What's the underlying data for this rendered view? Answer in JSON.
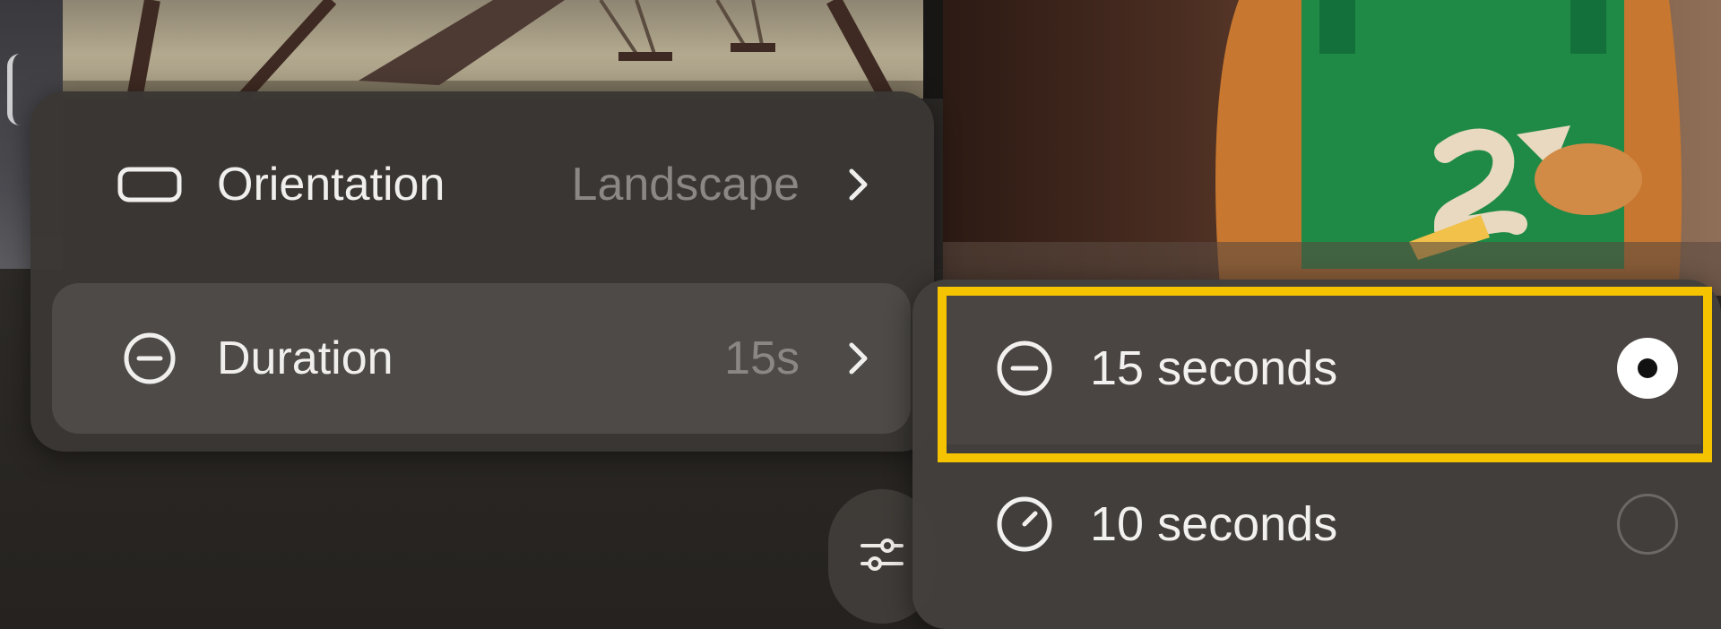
{
  "menu": {
    "orientation": {
      "label": "Orientation",
      "value": "Landscape",
      "icon": "rectangle-icon"
    },
    "duration": {
      "label": "Duration",
      "value": "15s",
      "icon": "timer-icon"
    }
  },
  "settings_button": {
    "icon": "sliders-icon"
  },
  "duration_options": [
    {
      "label": "15 seconds",
      "icon": "timer-icon",
      "selected": true
    },
    {
      "label": "10 seconds",
      "icon": "timer-icon",
      "selected": false
    }
  ],
  "colors": {
    "highlight": "#f5c300",
    "panel": "#3a3734",
    "selected_row": "#4d4a47",
    "text": "#f1efed",
    "muted_text": "#8a8784"
  }
}
